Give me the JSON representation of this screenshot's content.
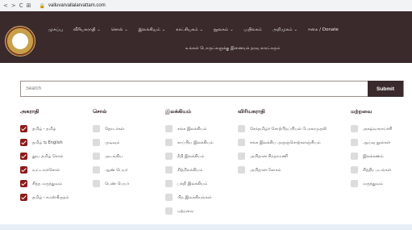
{
  "browser": {
    "url": "valluvarvallalarvattam.com",
    "nav_glyphs": [
      "<",
      ">",
      "C",
      "⊞"
    ]
  },
  "site": {
    "menu": [
      {
        "label": "முகப்பு",
        "has_dropdown": false
      },
      {
        "label": "வீரியகராதி",
        "has_dropdown": true
      },
      {
        "label": "சொல்",
        "has_dropdown": true
      },
      {
        "label": "இலக்கியம்",
        "has_dropdown": true
      },
      {
        "label": "காட்சியகம்",
        "has_dropdown": true
      },
      {
        "label": "நூலகம்",
        "has_dropdown": true
      },
      {
        "label": "பயிலகம்",
        "has_dropdown": false
      },
      {
        "label": "அறிமுகம்",
        "has_dropdown": true
      },
      {
        "label": "ஈகை / Donate",
        "has_dropdown": false
      }
    ],
    "tagline": "உங்கள் பொருட்களுக்கு இணையக் தரவு காரட்கரும்"
  },
  "search": {
    "placeholder": "Search",
    "button_label": "Submit"
  },
  "filters": {
    "columns": [
      {
        "heading": "அகராதி",
        "options": [
          {
            "label": "தமிழ் - தமிழ்",
            "checked": true
          },
          {
            "label": "தமிழ் ⇆ English",
            "checked": true
          },
          {
            "label": "தூய தமிழ் சொல்",
            "checked": true
          },
          {
            "label": "வட்டாரச்சொல்",
            "checked": true
          },
          {
            "label": "சித்த மருத்துவம்",
            "checked": true
          },
          {
            "label": "தமிழ் - சமஸ்கிருதம்",
            "checked": true
          }
        ]
      },
      {
        "heading": "சொல்",
        "options": [
          {
            "label": "தொடர்கள்",
            "checked": false
          },
          {
            "label": "முடிவும்",
            "checked": false
          },
          {
            "label": "அடங்கிய",
            "checked": false
          },
          {
            "label": "ஆண் பெயர்",
            "checked": false
          },
          {
            "label": "பெண் பெயர்",
            "checked": false
          }
        ]
      },
      {
        "heading": "இலக்கியம்",
        "options": [
          {
            "label": "சங்க இலக்கியம்",
            "checked": false
          },
          {
            "label": "காப்பிய இலக்கியம்",
            "checked": false
          },
          {
            "label": "நீதி இலக்கியம்",
            "checked": false
          },
          {
            "label": "சிற்றிலக்கியம்",
            "checked": false
          },
          {
            "label": "பக்தி இலக்கியம்",
            "checked": false
          },
          {
            "label": "பிற இலக்கியங்கள்",
            "checked": false
          },
          {
            "label": "மற்றவை",
            "checked": false
          }
        ]
      },
      {
        "heading": "விரியகராதி",
        "options": [
          {
            "label": "செந்தமிழ்ச் சொற்பிறப்பியல் பேரகரமுதலி",
            "checked": false
          },
          {
            "label": "சங்க இலக்கிய அருஞ்சொற்களஞ்சியம்",
            "checked": false
          },
          {
            "label": "அபிதான சிந்தாமணி",
            "checked": false
          },
          {
            "label": "அபிதான கோசம்",
            "checked": false
          }
        ]
      },
      {
        "heading": "மற்றவை",
        "options": [
          {
            "label": "அகழ்வாராய்ச்சி",
            "checked": false
          },
          {
            "label": "ஆய்வு நூல்கள்",
            "checked": false
          },
          {
            "label": "இலக்கணம்",
            "checked": false
          },
          {
            "label": "சித்திர படங்கள்",
            "checked": false
          },
          {
            "label": "மருத்துவம்",
            "checked": false
          }
        ]
      }
    ]
  },
  "colors": {
    "header_bg": "#3a2a2b",
    "checked_box": "#8c1b1b",
    "unchecked_box": "#dcdcdc",
    "submit_bg": "#3a2a2b"
  }
}
